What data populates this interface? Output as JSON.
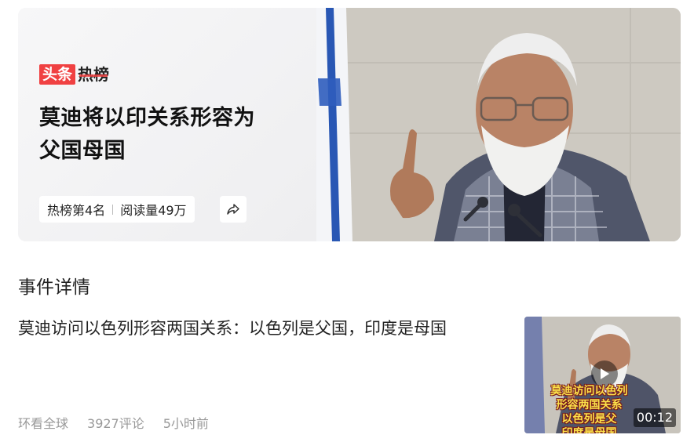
{
  "hero": {
    "brand_part1": "头条",
    "brand_part2": "热榜",
    "title": "莫迪将以印关系形容为父国母国",
    "rank_text": "热榜第4名",
    "reads_text": "阅读量49万",
    "share_icon": "share-arrow-icon",
    "photo_alt": "photo"
  },
  "event": {
    "section_title": "事件详情",
    "headline": "莫迪访问以色列形容两国关系：以色列是父国，印度是母国",
    "source": "环看全球",
    "comments": "3927评论",
    "time": "5小时前",
    "video": {
      "caption_line1": "莫迪访问以色列",
      "caption_line2": "形容两国关系",
      "caption_line3": "以色列是父",
      "caption_line4": "印度是母国",
      "duration": "00:12",
      "play_icon": "play-icon"
    }
  },
  "colors": {
    "brand_red": "#f04142",
    "caption_yellow": "#fbe14a",
    "meta_gray": "#999999"
  }
}
